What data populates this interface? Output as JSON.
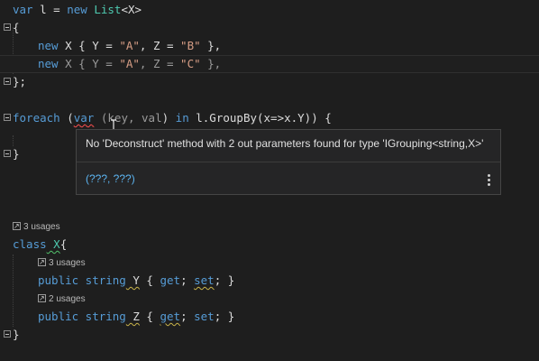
{
  "code": {
    "l1": {
      "kw_var": "var",
      "id_l": " l = ",
      "kw_new": "new",
      "type": " List",
      "gen": "<X>"
    },
    "l2": "{",
    "l3": {
      "kw_new": "new",
      "rest1": " X { Y = ",
      "s1": "\"A\"",
      "rest2": ", Z = ",
      "s2": "\"B\"",
      "rest3": " },"
    },
    "l4": {
      "kw_new": "new",
      "rest1": " X { Y = ",
      "s1": "\"A\"",
      "rest2": ", Z = ",
      "s2": "\"C\"",
      "rest3": " },"
    },
    "l5": "};",
    "l6": {
      "foreach": "foreach",
      "p1": " (",
      "var": "var",
      "sp": " (",
      "key": "key",
      "comma": ", ",
      "val": "val",
      "p2": ") ",
      "in": "in",
      "tail": " l.GroupBy(x=>x.Y)) {"
    },
    "l7": "}",
    "lens1": "3 usages",
    "l8": {
      "class": "class",
      "name": " X",
      "brace": "{"
    },
    "lens2": "3 usages",
    "l9": {
      "public": "public",
      "string": " string",
      "y": " Y",
      "rest": " { ",
      "get": "get",
      "semi1": "; ",
      "set": "set",
      "semi2": "; }"
    },
    "lens3": "2 usages",
    "l10": {
      "public": "public",
      "string": " string",
      "z": " Z",
      "rest": " { ",
      "get": "get",
      "semi1": "; ",
      "set": "set",
      "semi2": "; }"
    },
    "l11": "}"
  },
  "tooltip": {
    "message": "No 'Deconstruct' method with 2 out parameters found for type 'IGrouping<string,X>'",
    "fix": "(???, ???)"
  }
}
